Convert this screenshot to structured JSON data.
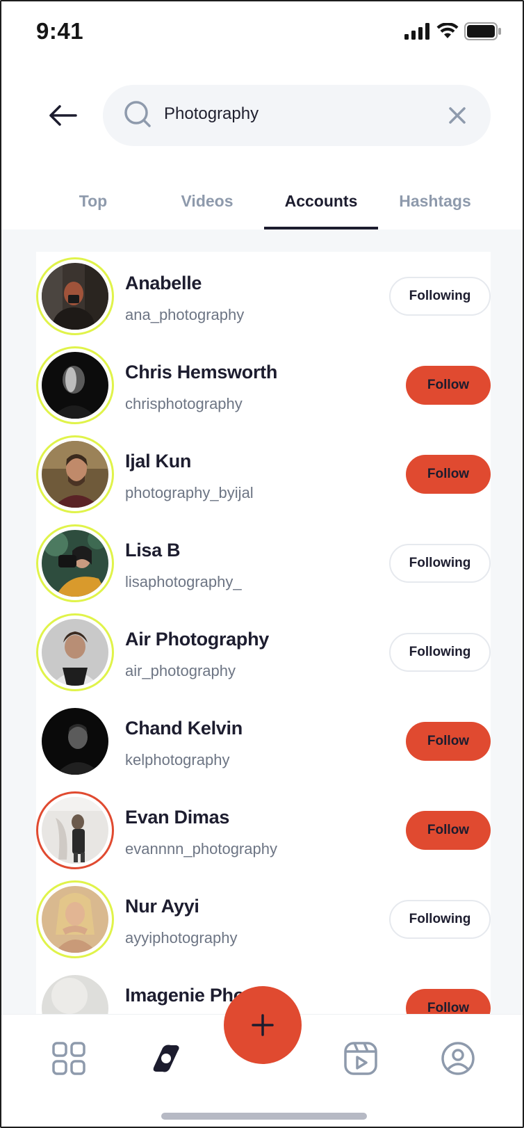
{
  "status_bar": {
    "time": "9:41"
  },
  "search": {
    "query": "Photography"
  },
  "tabs": [
    {
      "label": "Top",
      "active": false
    },
    {
      "label": "Videos",
      "active": false
    },
    {
      "label": "Accounts",
      "active": true
    },
    {
      "label": "Hashtags",
      "active": false
    }
  ],
  "accounts": [
    {
      "name": "Anabelle",
      "handle": "ana_photography",
      "button": "Following",
      "ring": "#e0f34a"
    },
    {
      "name": "Chris Hemsworth",
      "handle": "chrisphotography",
      "button": "Follow",
      "ring": "#e0f34a"
    },
    {
      "name": "Ijal Kun",
      "handle": "photography_byijal",
      "button": "Follow",
      "ring": "#e0f34a"
    },
    {
      "name": "Lisa B",
      "handle": "lisaphotography_",
      "button": "Following",
      "ring": "#e0f34a"
    },
    {
      "name": "Air Photography",
      "handle": "air_photography",
      "button": "Following",
      "ring": "#e0f34a"
    },
    {
      "name": "Chand Kelvin",
      "handle": "kelphotography",
      "button": "Follow",
      "ring": "none"
    },
    {
      "name": "Evan Dimas",
      "handle": "evannnn_photography",
      "button": "Follow",
      "ring": "#e04a30"
    },
    {
      "name": "Nur Ayyi",
      "handle": "ayyiphotography",
      "button": "Following",
      "ring": "#e0f34a"
    },
    {
      "name": "Imagenie Pho",
      "handle": "",
      "button": "Follow",
      "ring": "none"
    }
  ],
  "bottom_nav": [
    {
      "icon": "grid-icon"
    },
    {
      "icon": "explore-icon",
      "active": true
    },
    {
      "icon": "add-icon"
    },
    {
      "icon": "reels-icon"
    },
    {
      "icon": "profile-icon"
    }
  ],
  "colors": {
    "accent": "#e04a30",
    "ring_yellow": "#e0f34a",
    "text_dark": "#1c1c2e",
    "text_muted": "#8e9aac"
  }
}
